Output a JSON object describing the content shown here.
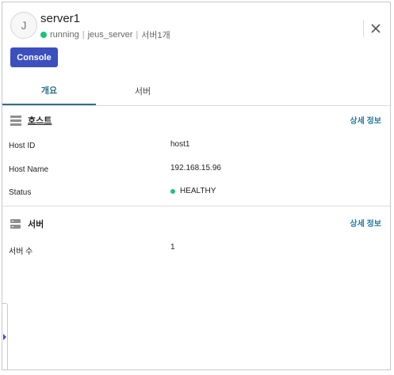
{
  "header": {
    "avatar_letter": "J",
    "title": "server1",
    "status": "running",
    "server_type": "jeus_server",
    "server_count": "서버1개",
    "separator": "|",
    "console_label": "Console"
  },
  "tabs": [
    {
      "label": "개요",
      "active": true
    },
    {
      "label": "서버",
      "active": false
    }
  ],
  "host_section": {
    "title": "호스트",
    "detail_link": "상세 정보",
    "rows": [
      {
        "label": "Host ID",
        "value": "host1"
      },
      {
        "label": "Host Name",
        "value": "192.168.15.96"
      },
      {
        "label": "Status",
        "value": "HEALTHY"
      }
    ]
  },
  "server_section": {
    "title": "서버",
    "detail_link": "상세 정보",
    "rows": [
      {
        "label": "서버 수",
        "value": "1"
      }
    ]
  },
  "colors": {
    "accent": "#3c4fbf",
    "tab_active": "#2f6f8c",
    "link": "#2a7aa5",
    "status_green": "#1fc27b"
  },
  "icons": {
    "close": "close-icon",
    "host": "host-icon",
    "server": "server-icon",
    "expand": "expand-arrow-icon"
  }
}
